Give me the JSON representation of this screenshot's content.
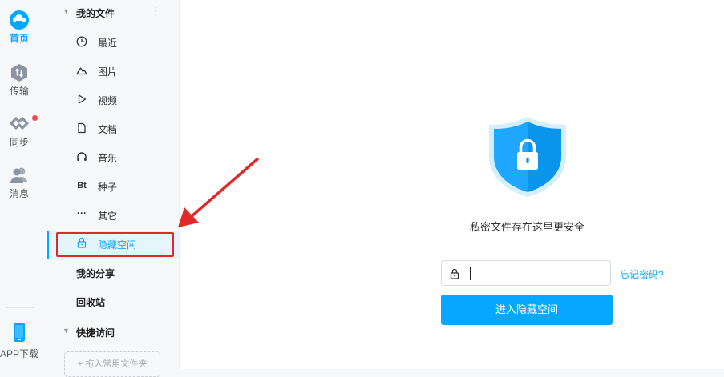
{
  "rail": {
    "home": "首页",
    "transfer": "传输",
    "sync": "同步",
    "messages": "消息",
    "app_download": "APP下载"
  },
  "sidebar": {
    "my_files": "我的文件",
    "more": "⋮",
    "items": [
      {
        "label": "最近",
        "icon": "clock-icon"
      },
      {
        "label": "图片",
        "icon": "mountain-icon"
      },
      {
        "label": "视频",
        "icon": "play-icon"
      },
      {
        "label": "文档",
        "icon": "document-icon"
      },
      {
        "label": "音乐",
        "icon": "headphones-icon"
      },
      {
        "label": "种子",
        "icon_text": "Bt",
        "icon": "bt-icon"
      },
      {
        "label": "其它",
        "icon_text": "···",
        "icon": "ellipsis-icon"
      },
      {
        "label": "隐藏空间",
        "icon": "lock-icon"
      }
    ],
    "my_share": "我的分享",
    "recycle_bin": "回收站",
    "quick_access": "快捷访问",
    "quick_add": "+ 拖入常用文件夹"
  },
  "main": {
    "tagline": "私密文件存在这里更安全",
    "password_value": "",
    "forgot": "忘记密码?",
    "enter_button": "进入隐藏空间"
  },
  "colors": {
    "accent": "#06a7ff",
    "annotation": "#e02a2a",
    "badge": "#f2474a"
  }
}
